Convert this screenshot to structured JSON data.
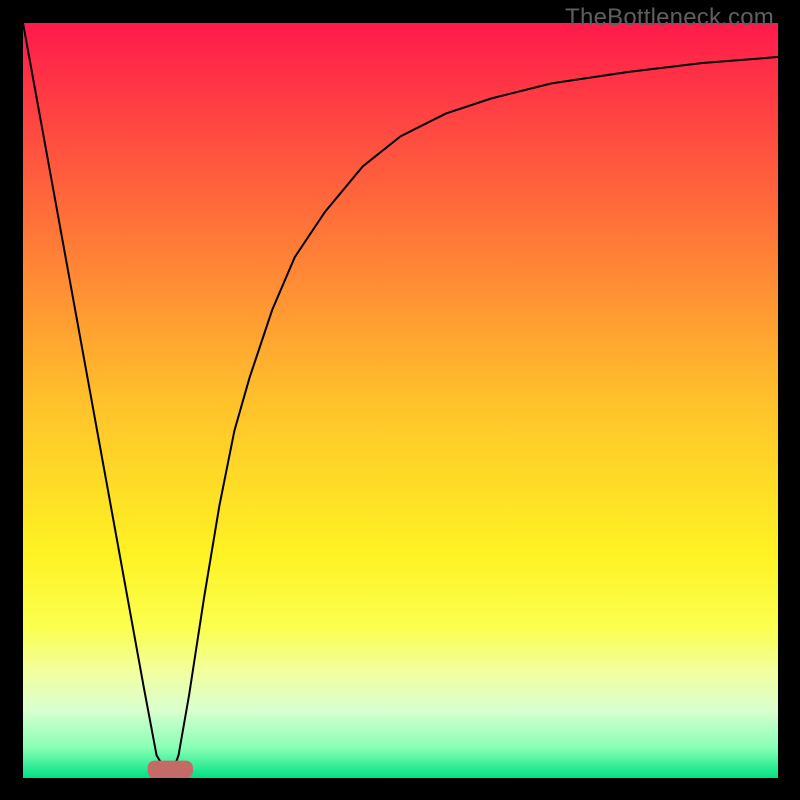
{
  "watermark": "TheBottleneck.com",
  "chart_data": {
    "type": "line",
    "title": "",
    "xlabel": "",
    "ylabel": "",
    "xlim": [
      0,
      100
    ],
    "ylim": [
      0,
      100
    ],
    "grid": false,
    "legend": false,
    "background": {
      "type": "vertical-gradient",
      "stops": [
        {
          "pos": 0.0,
          "color": "#ff1a4b"
        },
        {
          "pos": 0.25,
          "color": "#ff6d3a"
        },
        {
          "pos": 0.5,
          "color": "#ffc12b"
        },
        {
          "pos": 0.7,
          "color": "#fef223"
        },
        {
          "pos": 0.8,
          "color": "#fbff4e"
        },
        {
          "pos": 0.86,
          "color": "#f2ffa0"
        },
        {
          "pos": 0.91,
          "color": "#d9ffcf"
        },
        {
          "pos": 0.96,
          "color": "#88ffb5"
        },
        {
          "pos": 1.0,
          "color": "#00e082"
        }
      ]
    },
    "series": [
      {
        "name": "bottleneck-curve",
        "color": "#000000",
        "stroke_width": 2,
        "x": [
          0,
          4,
          8,
          12,
          16,
          17.7,
          19.5,
          20.6,
          22,
          24,
          26,
          28,
          30,
          33,
          36,
          40,
          45,
          50,
          56,
          62,
          70,
          80,
          90,
          100
        ],
        "y": [
          100,
          78,
          56,
          34,
          12,
          3,
          0,
          3,
          11,
          24,
          36,
          46,
          53,
          62,
          69,
          75,
          81,
          85,
          88,
          90,
          92,
          93.5,
          94.7,
          95.5
        ]
      }
    ],
    "marker": {
      "name": "optimal-band",
      "shape": "rounded-rect",
      "x_center": 19.5,
      "y": 0,
      "width": 6.0,
      "height": 2.3,
      "fill": "#c46a67"
    }
  }
}
